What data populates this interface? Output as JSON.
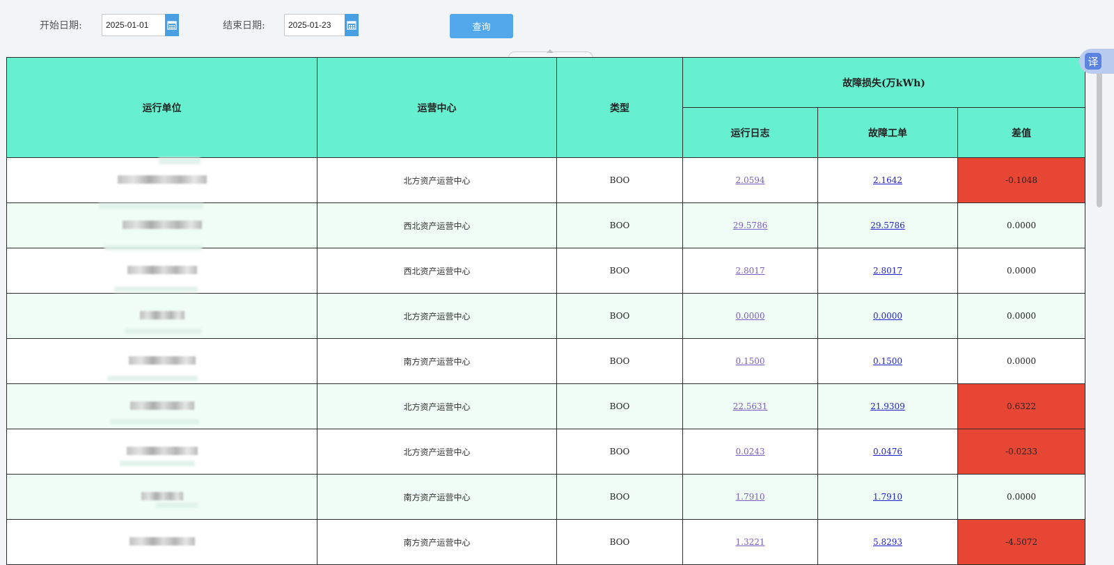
{
  "filters": {
    "start_label": "开始日期:",
    "start_value": "2025-01-01",
    "end_label": "结束日期:",
    "end_value": "2025-01-23",
    "query_label": "查询"
  },
  "table": {
    "headers": {
      "unit": "运行单位",
      "center": "运营中心",
      "type": "类型",
      "loss_group": "故障损失(万kWh)",
      "log": "运行日志",
      "order": "故障工单",
      "diff": "差值"
    },
    "rows": [
      {
        "center": "北方资产运营中心",
        "type": "BOO",
        "log": "2.0594",
        "order": "2.1642",
        "diff": "-0.1048",
        "highlight": true
      },
      {
        "center": "西北资产运营中心",
        "type": "BOO",
        "log": "29.5786",
        "order": "29.5786",
        "diff": "0.0000",
        "highlight": false
      },
      {
        "center": "西北资产运营中心",
        "type": "BOO",
        "log": "2.8017",
        "order": "2.8017",
        "diff": "0.0000",
        "highlight": false
      },
      {
        "center": "北方资产运营中心",
        "type": "BOO",
        "log": "0.0000",
        "order": "0.0000",
        "diff": "0.0000",
        "highlight": false
      },
      {
        "center": "南方资产运营中心",
        "type": "BOO",
        "log": "0.1500",
        "order": "0.1500",
        "diff": "0.0000",
        "highlight": false
      },
      {
        "center": "北方资产运营中心",
        "type": "BOO",
        "log": "22.5631",
        "order": "21.9309",
        "diff": "0.6322",
        "highlight": true
      },
      {
        "center": "北方资产运营中心",
        "type": "BOO",
        "log": "0.0243",
        "order": "0.0476",
        "diff": "-0.0233",
        "highlight": true
      },
      {
        "center": "南方资产运营中心",
        "type": "BOO",
        "log": "1.7910",
        "order": "1.7910",
        "diff": "0.0000",
        "highlight": false
      },
      {
        "center": "南方资产运营中心",
        "type": "BOO",
        "log": "1.3221",
        "order": "5.8293",
        "diff": "-4.5072",
        "highlight": true
      }
    ]
  },
  "translate": {
    "glyph": "译"
  },
  "colors": {
    "header_bg": "#66f0d0",
    "alert_bg": "#e84635",
    "button_bg": "#52a8ea"
  }
}
